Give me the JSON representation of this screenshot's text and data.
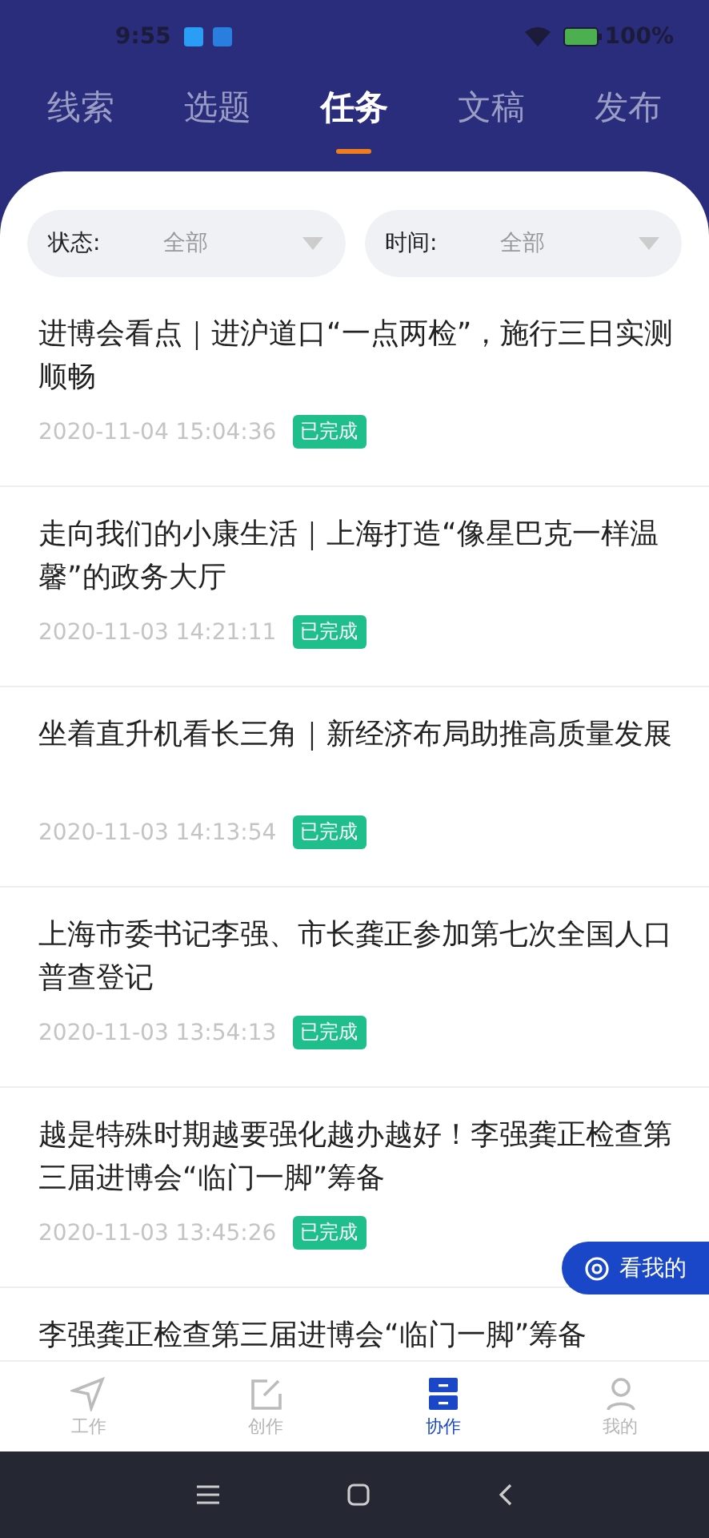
{
  "status_bar": {
    "time": "9:55",
    "battery": "100%"
  },
  "tabs": [
    {
      "label": "线索",
      "selected": false
    },
    {
      "label": "选题",
      "selected": false
    },
    {
      "label": "任务",
      "selected": true
    },
    {
      "label": "文稿",
      "selected": false
    },
    {
      "label": "发布",
      "selected": false
    }
  ],
  "filters": [
    {
      "label": "状态:",
      "value": "全部"
    },
    {
      "label": "时间:",
      "value": "全部"
    }
  ],
  "tasks": [
    {
      "title": "进博会看点｜进沪道口“一点两检”，施行三日实测顺畅",
      "time": "2020-11-04 15:04:36",
      "status": "已完成"
    },
    {
      "title": "走向我们的小康生活｜上海打造“像星巴克一样温馨”的政务大厅",
      "time": "2020-11-03 14:21:11",
      "status": "已完成"
    },
    {
      "title": "坐着直升机看长三角｜新经济布局助推高质量发展",
      "time": "2020-11-03 14:13:54",
      "status": "已完成"
    },
    {
      "title": "上海市委书记李强、市长龚正参加第七次全国人口普查登记",
      "time": "2020-11-03 13:54:13",
      "status": "已完成"
    },
    {
      "title": "越是特殊时期越要强化越办越好！李强龚正检查第三届进博会“临门一脚”筹备",
      "time": "2020-11-03 13:45:26",
      "status": "已完成"
    },
    {
      "title": "李强龚正检查第三届进博会“临门一脚”筹备"
    }
  ],
  "float_button": {
    "label": "看我的"
  },
  "bottom_nav": [
    {
      "label": "工作",
      "kind": "send",
      "selected": false
    },
    {
      "label": "创作",
      "kind": "edit",
      "selected": false
    },
    {
      "label": "协作",
      "kind": "drawer",
      "selected": true
    },
    {
      "label": "我的",
      "kind": "user",
      "selected": false
    }
  ]
}
